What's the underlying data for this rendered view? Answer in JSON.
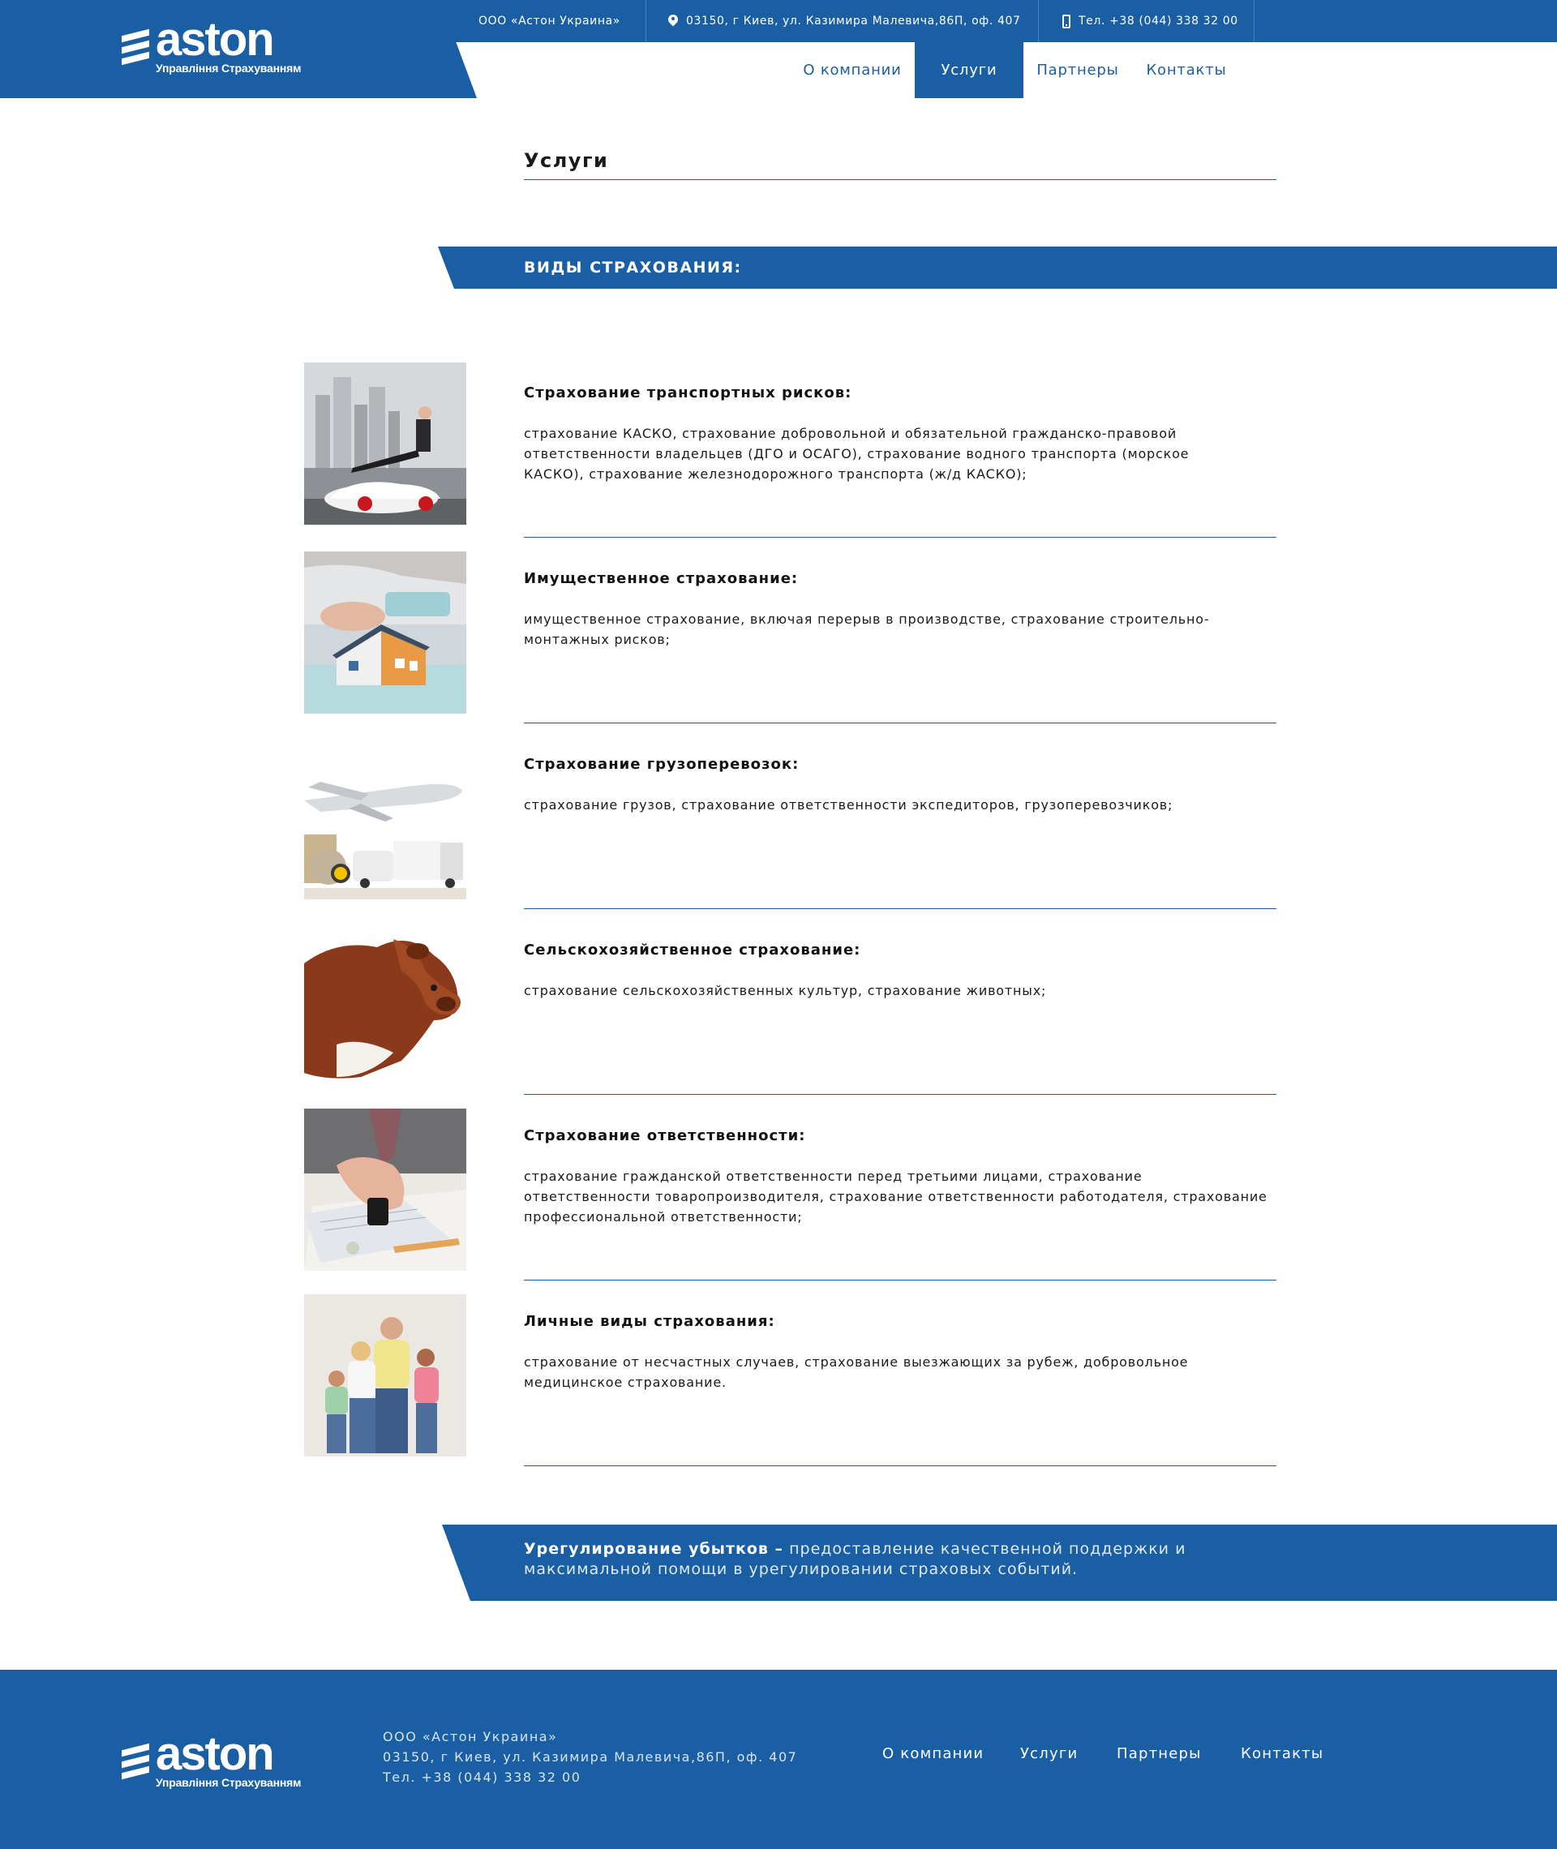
{
  "brand": {
    "name": "aston",
    "tagline": "Управління Страхуванням"
  },
  "topbar": {
    "company": "ООО «Астон Украина»",
    "address": "03150, г Киев, ул. Казимира Малевича,86П, оф. 407",
    "phone": "Тел. +38 (044) 338 32 00",
    "address_icon": "map-pin-icon",
    "phone_icon": "mobile-phone-icon"
  },
  "nav": {
    "items": [
      {
        "label": "О компании"
      },
      {
        "label": "Услуги"
      },
      {
        "label": "Партнеры"
      },
      {
        "label": "Контакты"
      }
    ],
    "active": "Услуги"
  },
  "page": {
    "title": "Услуги",
    "section_label": "ВИДЫ СТРАХОВАНИЯ:"
  },
  "services": [
    {
      "title": "Страхование транспортных рисков:",
      "desc_lines": [
        "страхование КАСКО, страхование добровольной и обязательной гражданско-правовой",
        "ответственности владельцев (ДГО и ОСАГО), страхование водного транспорта (морское",
        "КАСКО), страхование железнодорожного транспорта (ж/д КАСКО);"
      ]
    },
    {
      "title": "Имущественное страхование:",
      "desc_lines": [
        "имущественное страхование, включая перерыв в производстве, страхование строительно-",
        "монтажных рисков;"
      ]
    },
    {
      "title": "Страхование грузоперевозок:",
      "desc_lines": [
        "страхование грузов, страхование ответственности экспедиторов, грузоперевозчиков;"
      ]
    },
    {
      "title": "Сельскохозяйственное страхование:",
      "desc_lines": [
        "страхование сельскохозяйственных культур, страхование животных;"
      ]
    },
    {
      "title": "Страхование ответственности:",
      "desc_lines": [
        "страхование гражданской ответственности перед третьими лицами, страхование",
        "ответственности товаропроизводителя, страхование ответственности работодателя, страхование",
        "профессиональной ответственности;"
      ]
    },
    {
      "title": "Личные виды страхования:",
      "desc_lines": [
        "страхование от несчастных случаев, страхование выезжающих за рубеж, добровольное",
        "медицинское страхование."
      ]
    }
  ],
  "claims": {
    "lead": "Урегулирование убытков –",
    "line1": "предоставление качественной поддержки и",
    "line2": "максимальной помощи в урегулировании страховых событий."
  },
  "footer": {
    "company": "ООО «Астон Украина»",
    "address": "03150, г Киев, ул. Казимира Малевича,86П, оф. 407",
    "phone": "Тел. +38 (044) 338 32 00",
    "nav": [
      {
        "label": "О компании"
      },
      {
        "label": "Услуги"
      },
      {
        "label": "Партнеры"
      },
      {
        "label": "Контакты"
      }
    ]
  },
  "colors": {
    "brand_blue": "#1a5fa3",
    "text": "#1a1a1a",
    "white": "#ffffff"
  }
}
